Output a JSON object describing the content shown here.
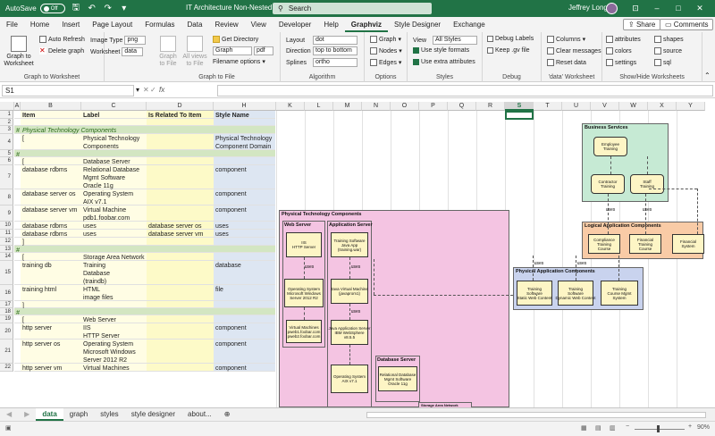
{
  "titlebar": {
    "autosave_label": "AutoSave",
    "autosave_state": "Off",
    "document_title": "IT Architecture Non-Nested.xlsm",
    "search_placeholder": "Search",
    "user_name": "Jeffrey Long"
  },
  "menu": {
    "tabs": [
      "File",
      "Home",
      "Insert",
      "Page Layout",
      "Formulas",
      "Data",
      "Review",
      "View",
      "Developer",
      "Help",
      "Graphviz",
      "Style Designer",
      "Exchange"
    ],
    "active": "Graphviz",
    "share": "Share",
    "comments": "Comments"
  },
  "ribbon": {
    "g1": {
      "label": "Graph to Worksheet",
      "graph_to_worksheet": "Graph to\nWorksheet",
      "auto_refresh": "Auto Refresh",
      "delete_graph": "Delete graph",
      "image_type_label": "Image Type",
      "image_type": "png",
      "worksheet_label": "Worksheet",
      "worksheet": "data"
    },
    "g2": {
      "label": "Graph to File",
      "graph_to_file": "Graph\nto File",
      "all_views": "All views\nto File",
      "get_directory": "Get Directory",
      "file_name": "Graph",
      "file_ext": "pdf",
      "filename_options": "Filename options"
    },
    "g3": {
      "label": "Algorithm",
      "layout_label": "Layout",
      "layout": "dot",
      "direction_label": "Direction",
      "direction": "top to bottom",
      "splines_label": "Splines",
      "splines": "ortho"
    },
    "g4": {
      "label": "Options",
      "graph": "Graph",
      "nodes": "Nodes",
      "edges": "Edges"
    },
    "g5": {
      "label": "Styles",
      "view_label": "View",
      "view": "All Styles",
      "use_style_formats": "Use style formats",
      "use_extra_attributes": "Use extra attributes"
    },
    "g6": {
      "label": "Debug",
      "debug_labels": "Debug Labels",
      "keep_gv_file": "Keep .gv file"
    },
    "g7": {
      "label": "'data' Worksheet",
      "columns": "Columns",
      "clear_messages": "Clear messages",
      "reset_data": "Reset data"
    },
    "g8": {
      "label": "Show/Hide Worksheets",
      "attributes": "attributes",
      "colors": "colors",
      "settings": "settings",
      "shapes": "shapes",
      "source": "source",
      "sql": "sql"
    }
  },
  "formula_bar": {
    "name_box": "S1",
    "fx": "fx",
    "value": ""
  },
  "columns": [
    "A",
    "B",
    "C",
    "D",
    "E",
    "F",
    "G",
    "H",
    "I",
    "J",
    "K",
    "L",
    "M",
    "N",
    "O",
    "P",
    "Q",
    "R",
    "S",
    "T",
    "U",
    "V",
    "W",
    "X",
    "Y"
  ],
  "selected_column": "S",
  "rows": [
    {
      "n": "1",
      "a": "",
      "b": "Item",
      "c": "Label",
      "d": "Is Related To Item",
      "e": "Style Name",
      "hdr": true
    },
    {
      "n": "2",
      "a": "",
      "b": "",
      "c": "",
      "d": "",
      "e": ""
    },
    {
      "n": "3",
      "a": "#",
      "b": "Physical Technology Components",
      "c": "",
      "d": "",
      "e": "",
      "comment": true
    },
    {
      "n": "4",
      "a": "",
      "b": "[",
      "c": "Physical Technology\nComponents",
      "d": "",
      "e": "Physical Technology\nComponent Domain"
    },
    {
      "n": "5",
      "a": "#",
      "b": "",
      "c": "",
      "d": "",
      "e": "",
      "comment": true
    },
    {
      "n": "6",
      "a": "",
      "b": "[",
      "c": "Database Server",
      "d": "",
      "e": ""
    },
    {
      "n": "7",
      "a": "",
      "b": "database rdbms",
      "c": "Relational Database\nMgmt Software\nOracle 11g",
      "d": "",
      "e": "component"
    },
    {
      "n": "8",
      "a": "",
      "b": "database server os",
      "c": "Operating System\nAIX v7.1",
      "d": "",
      "e": "component"
    },
    {
      "n": "9",
      "a": "",
      "b": "database server vm",
      "c": "Virtual Machine\npdb1.foobar.com",
      "d": "",
      "e": "component"
    },
    {
      "n": "10",
      "a": "",
      "b": "database rdbms",
      "c": "uses",
      "d": "database server os",
      "e": "uses"
    },
    {
      "n": "11",
      "a": "",
      "b": "database rdbms",
      "c": "uses",
      "d": "database server vm",
      "e": "uses"
    },
    {
      "n": "12",
      "a": "",
      "b": "]",
      "c": "",
      "d": "",
      "e": ""
    },
    {
      "n": "13",
      "a": "#",
      "b": "",
      "c": "",
      "d": "",
      "e": "",
      "comment": true
    },
    {
      "n": "14",
      "a": "",
      "b": "[",
      "c": "Storage Area Network",
      "d": "",
      "e": ""
    },
    {
      "n": "15",
      "a": "",
      "b": "training db",
      "c": "Training\nDatabase\n(traindb)",
      "d": "",
      "e": "database"
    },
    {
      "n": "16",
      "a": "",
      "b": "training html",
      "c": "HTML\nimage files",
      "d": "",
      "e": "file"
    },
    {
      "n": "17",
      "a": "",
      "b": "]",
      "c": "",
      "d": "",
      "e": ""
    },
    {
      "n": "18",
      "a": "#",
      "b": "",
      "c": "",
      "d": "",
      "e": "",
      "comment": true
    },
    {
      "n": "19",
      "a": "",
      "b": "[",
      "c": "Web Server",
      "d": "",
      "e": ""
    },
    {
      "n": "20",
      "a": "",
      "b": "http server",
      "c": "IIS\nHTTP Server",
      "d": "",
      "e": "component"
    },
    {
      "n": "21",
      "a": "",
      "b": "http server os",
      "c": "Operating System\nMicrosoft Windows\nServer 2012 R2",
      "d": "",
      "e": "component"
    },
    {
      "n": "22",
      "a": "",
      "b": "http server vm",
      "c": "Virtual Machines",
      "d": "",
      "e": "component"
    }
  ],
  "diagram": {
    "business_services": {
      "title": "Business Services",
      "nodes": [
        "Employee\nTraining",
        "Contractor\nTraining",
        "Staff\nTraining"
      ]
    },
    "logical_app": {
      "title": "Logical Application Components",
      "nodes": [
        "Compliance\nTraining\nCourse",
        "Financial\nTraining\nCourse",
        "Financial\nSystem"
      ]
    },
    "physical_app": {
      "title": "Physical Application Components",
      "nodes": [
        "Training\nSoftware\nStatic Web Content",
        "Training\nSoftware\nDynamic Web Content",
        "Training\nCourse Mgmt\nSystem"
      ]
    },
    "physical_tech": {
      "title": "Physical Technology Components"
    },
    "web_server": {
      "title": "Web Server",
      "nodes": [
        "IIS\nHTTP Server",
        "Operating System\nMicrosoft Windows\nServer 2012 R2",
        "Virtual Machines\npweb1.foobar.com\npweb2.foobar.com"
      ]
    },
    "app_server": {
      "title": "Application Server",
      "nodes": [
        "Training Software\nJava App\n(training.war)",
        "Java Virtual Machine\n(javaprom1)",
        "Java Application Server\nIBM WebSphere\nv8.5.5",
        "Operating System\nAIX v7.1"
      ]
    },
    "db_server": {
      "title": "Database Server",
      "nodes": [
        "Relational Database\nMgmt Software\nOracle 11g"
      ]
    },
    "san": {
      "title": "Storage Area Network"
    },
    "edge_labels": [
      "uses",
      "uses",
      "uses",
      "uses",
      "uses",
      "uses",
      "uses"
    ]
  },
  "sheet_tabs": [
    "data",
    "graph",
    "styles",
    "style designer",
    "about..."
  ],
  "active_sheet": "data",
  "zoom": "90%"
}
